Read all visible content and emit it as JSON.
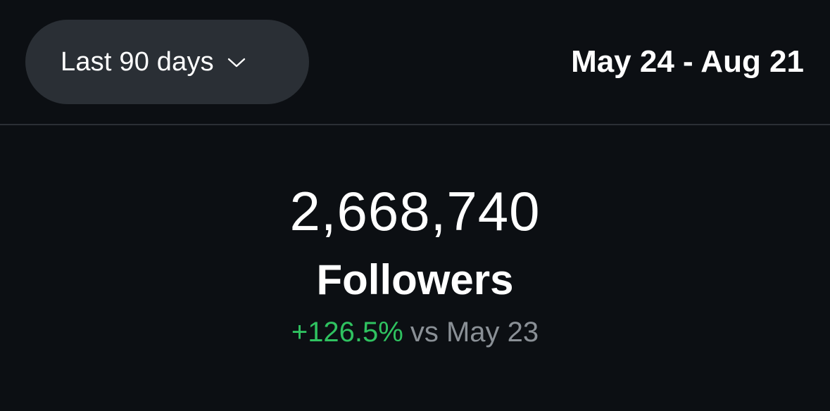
{
  "header": {
    "range_selector": {
      "label": "Last 90 days",
      "icon": "chevron-down-icon"
    },
    "date_range": "May 24 - Aug 21"
  },
  "stat": {
    "value": "2,668,740",
    "label": "Followers",
    "change_percent": "+126.5%",
    "change_compare": "vs May 23"
  },
  "colors": {
    "background": "#0c0f13",
    "pill": "#2a2f35",
    "positive": "#2fc260",
    "muted": "#8a9096"
  }
}
